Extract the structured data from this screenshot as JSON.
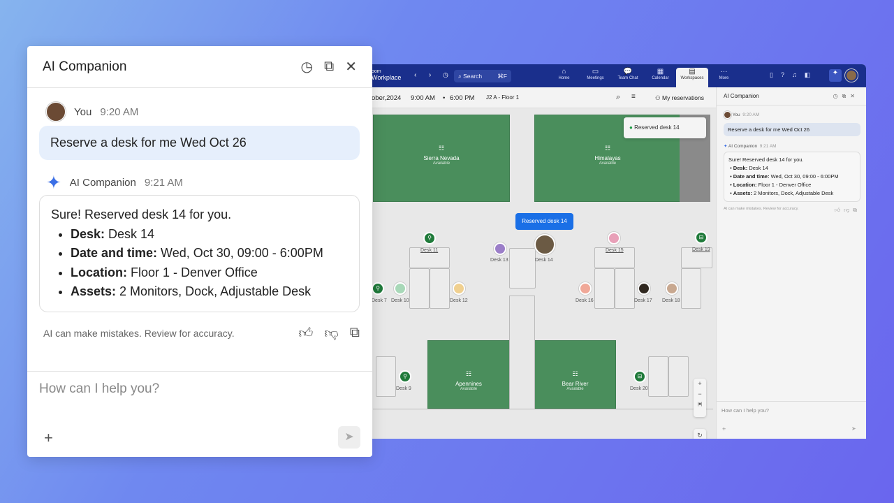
{
  "app": {
    "brand_line1": "oom",
    "brand_line2": "Workplace",
    "search_placeholder": "Search",
    "search_shortcut": "⌘F",
    "nav": [
      {
        "label": "Home",
        "icon": "⌂"
      },
      {
        "label": "Meetings",
        "icon": "▭"
      },
      {
        "label": "Team Chat",
        "icon": "💬"
      },
      {
        "label": "Calendar",
        "icon": "▦"
      },
      {
        "label": "Workspaces",
        "icon": "▤"
      },
      {
        "label": "More",
        "icon": "···"
      }
    ],
    "active_nav": "Workspaces"
  },
  "toolbar": {
    "date": "ober,2024",
    "start": "9:00 AM",
    "sep": "•",
    "end": "6:00 PM",
    "floor": "J2 A - Floor 1",
    "my_reservations": "My reservations"
  },
  "map": {
    "rooms": [
      {
        "name": "Sierra Nevada",
        "status": "Available"
      },
      {
        "name": "Himalayas",
        "status": "Available"
      },
      {
        "name": "Apennines",
        "status": "Available"
      },
      {
        "name": "Bear River",
        "status": "Available"
      }
    ],
    "desks": [
      "Desk 11",
      "Desk 13",
      "Desk 14",
      "Desk 15",
      "Desk 19",
      "Desk 7",
      "Desk 10",
      "Desk 12",
      "Desk 16",
      "Desk 17",
      "Desk 18",
      "Desk 9",
      "Desk 20"
    ],
    "toast": "Reserved desk 14",
    "tooltip": "Reserved desk 14",
    "zoom_in": "+",
    "zoom_out": "−",
    "fit": "|■|",
    "reset": "↻"
  },
  "mini": {
    "title": "AI Companion",
    "you": "You",
    "you_time": "9:20 AM",
    "prompt": "Reserve a desk for me Wed Oct 26",
    "ai": "AI Companion",
    "ai_time": "9:21 AM",
    "disclaimer": "AI can make mistakes. Review for accuracy.",
    "placeholder": "How can I help you?"
  },
  "panel": {
    "title": "AI Companion",
    "you": "You",
    "you_time": "9:20 AM",
    "prompt": "Reserve a desk for me Wed Oct 26",
    "ai": "AI Companion",
    "ai_time": "9:21 AM",
    "reply_intro": "Sure! Reserved desk 14 for you.",
    "items": [
      {
        "k": "Desk:",
        "v": " Desk 14"
      },
      {
        "k": "Date and time:",
        "v": " Wed, Oct 30, 09:00 - 6:00PM"
      },
      {
        "k": "Location:",
        "v": " Floor 1 - Denver Office"
      },
      {
        "k": "Assets:",
        "v": " 2 Monitors, Dock, Adjustable Desk"
      }
    ],
    "disclaimer": "AI can make mistakes. Review for accuracy.",
    "placeholder": "How can I help you?"
  },
  "colors": {
    "accent": "#1a2f8c",
    "room": "#4a8e5c",
    "tooltip": "#1a6fe6",
    "bubble": "#e6effc"
  }
}
